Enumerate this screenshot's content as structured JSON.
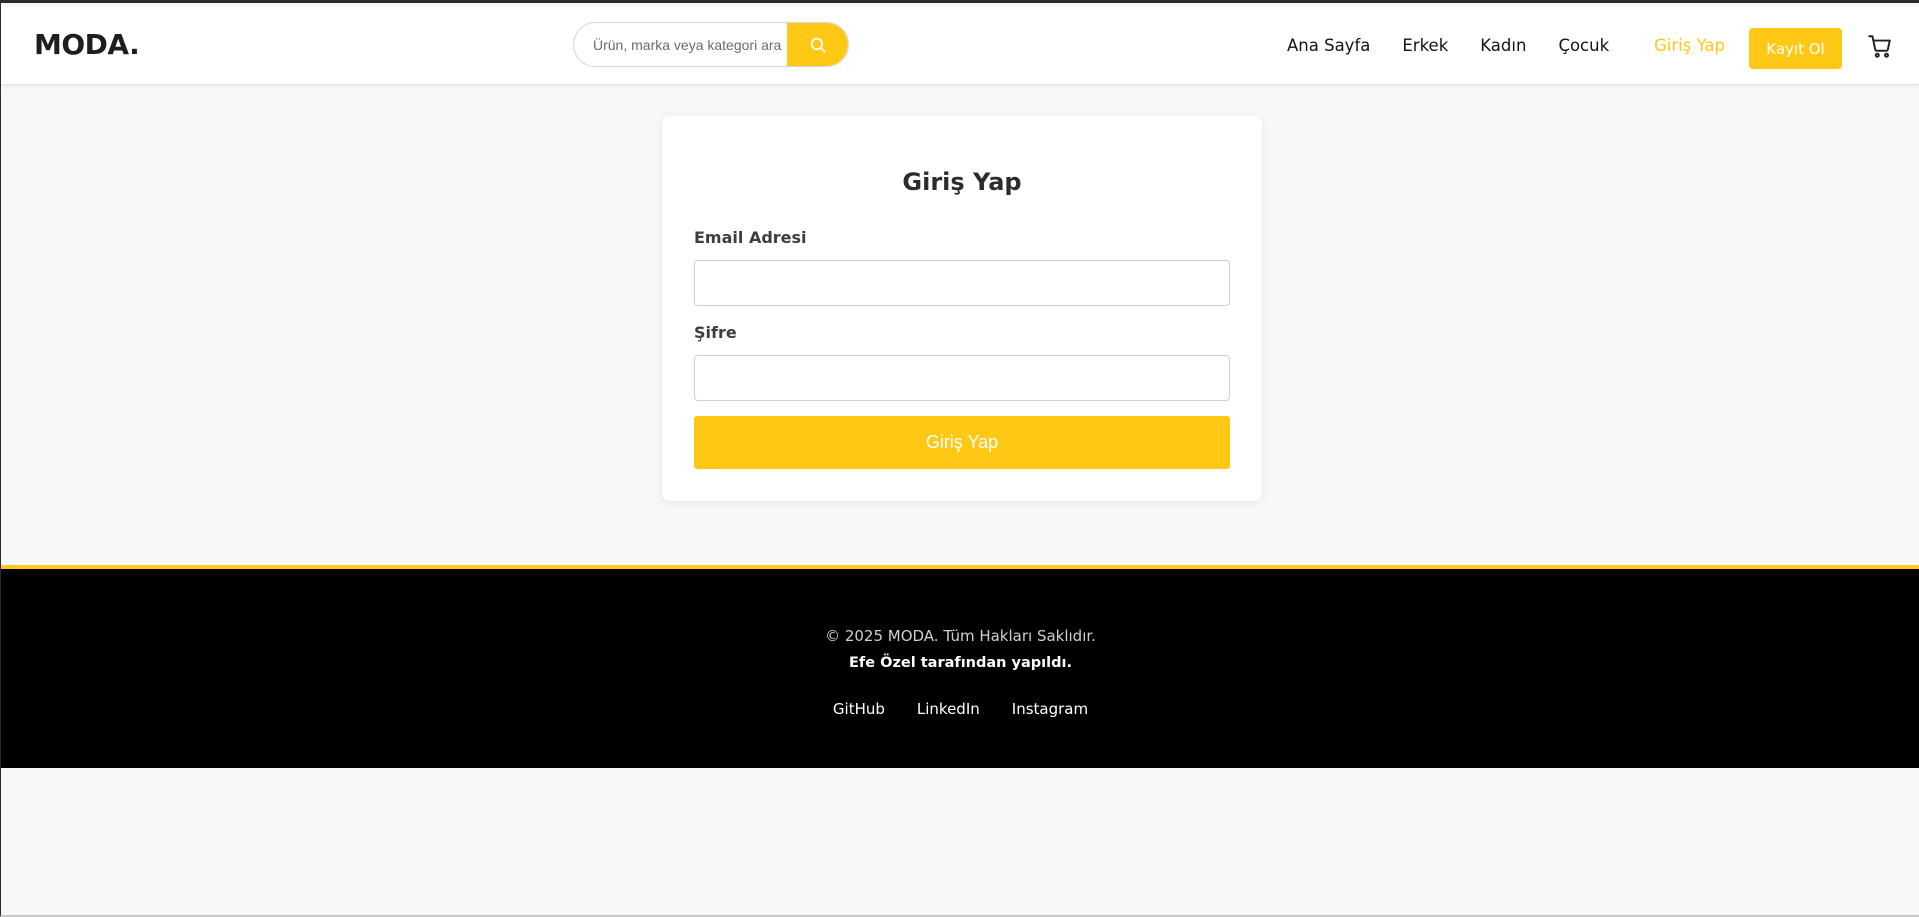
{
  "header": {
    "logo": "MODA.",
    "search": {
      "placeholder": "Ürün, marka veya kategori ara"
    },
    "nav": [
      {
        "label": "Ana Sayfa"
      },
      {
        "label": "Erkek"
      },
      {
        "label": "Kadın"
      },
      {
        "label": "Çocuk"
      }
    ],
    "login_label": "Giriş Yap",
    "register_label": "Kayıt Ol",
    "icons": {
      "search": "search-icon",
      "cart": "cart-icon"
    }
  },
  "login_form": {
    "title": "Giriş Yap",
    "email_label": "Email Adresi",
    "email_value": "",
    "password_label": "Şifre",
    "password_value": "",
    "submit_label": "Giriş Yap"
  },
  "footer": {
    "copyright": "© 2025 MODA. Tüm Hakları Saklıdır.",
    "author": "Efe Özel tarafından yapıldı.",
    "links": [
      {
        "label": "GitHub"
      },
      {
        "label": "LinkedIn"
      },
      {
        "label": "Instagram"
      }
    ]
  },
  "colors": {
    "accent": "#ffc815",
    "background": "#f7f8fa",
    "footer_bg": "#000000"
  }
}
